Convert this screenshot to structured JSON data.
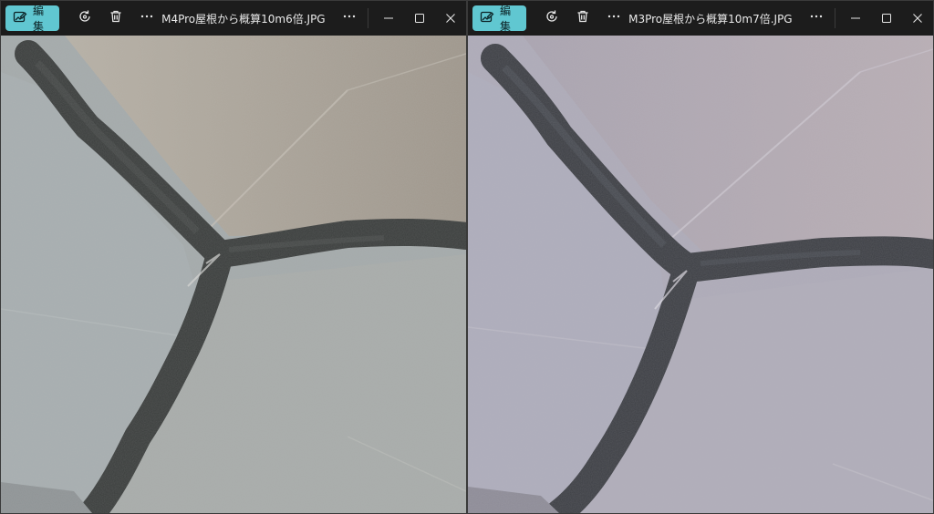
{
  "windows": [
    {
      "edit_label": "編集",
      "filename": "M4Pro屋根から概算10m6倍.JPG",
      "photo": {
        "tone": "neutral",
        "tile_color": "#a6abab",
        "top_color": "#b0aaa0",
        "seal_color": "#3a3d3c"
      }
    },
    {
      "edit_label": "編集",
      "filename": "M3Pro屋根から概算10m7倍.JPG",
      "photo": {
        "tone": "purple",
        "tile_color": "#aca9b6",
        "top_color": "#b5adb8",
        "seal_color": "#3d3f44"
      }
    }
  ],
  "icons": {
    "edit": "image-edit-icon",
    "rotate": "rotate-icon",
    "delete": "trash-icon",
    "more": "more-icon",
    "minimize": "minimize-icon",
    "maximize": "maximize-icon",
    "close": "close-icon"
  },
  "colors": {
    "accent": "#60c7d1",
    "titlebar": "#1c1c1c"
  }
}
